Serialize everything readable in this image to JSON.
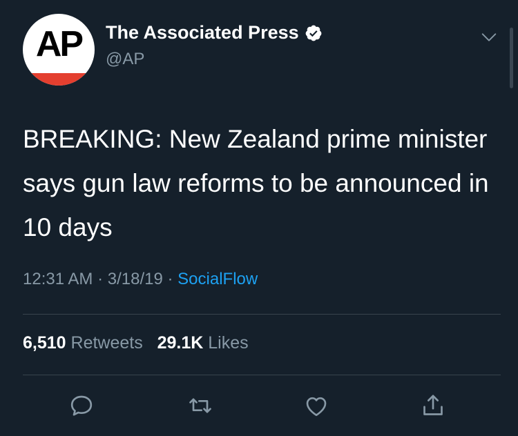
{
  "account": {
    "avatar_text": "AP",
    "display_name": "The Associated Press",
    "handle": "@AP",
    "verified": true
  },
  "tweet": {
    "text": "BREAKING: New Zealand prime minister says gun law reforms to be announced in 10 days",
    "time": "12:31 AM",
    "date": "3/18/19",
    "separator": "·",
    "source": "SocialFlow"
  },
  "stats": {
    "retweets_count": "6,510",
    "retweets_label": "Retweets",
    "likes_count": "29.1K",
    "likes_label": "Likes"
  },
  "actions": [
    "reply-icon",
    "retweet-icon",
    "like-icon",
    "share-icon"
  ],
  "colors": {
    "background": "#15202b",
    "text": "#ffffff",
    "secondary": "#8899a6",
    "link": "#1da1f2",
    "divider": "#38444d",
    "ap_red": "#e43f2f"
  }
}
